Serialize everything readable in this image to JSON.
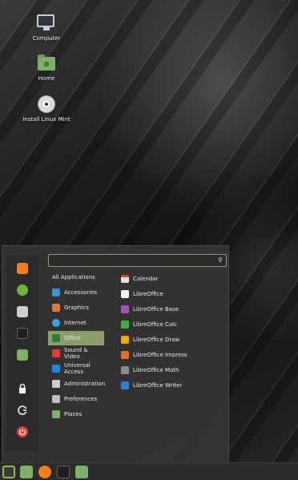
{
  "desktop": {
    "icons": [
      {
        "label": "Computer",
        "icon": "computer-icon"
      },
      {
        "label": "Home",
        "icon": "home-folder-icon"
      },
      {
        "label": "Install Linux Mint",
        "icon": "disc-icon"
      }
    ]
  },
  "menu": {
    "search": {
      "placeholder": "",
      "icon": "search-icon"
    },
    "favorites": [
      {
        "name": "firefox",
        "color": "#f57c1f"
      },
      {
        "name": "software-manager",
        "color": "#6fb23f"
      },
      {
        "name": "settings",
        "color": "#cfcfcf"
      },
      {
        "name": "terminal",
        "color": "#1e1e1e"
      },
      {
        "name": "files",
        "color": "#7fb069"
      },
      {
        "name": "lock-screen",
        "color": "#f2f2f2"
      },
      {
        "name": "logout",
        "color": "#f2f2f2"
      },
      {
        "name": "quit",
        "color": "#e53935"
      }
    ],
    "categories": [
      {
        "label": "All Applications",
        "color": "",
        "selected": false
      },
      {
        "label": "Accessories",
        "color": "#3d8fd6",
        "selected": false
      },
      {
        "label": "Graphics",
        "color": "#e07b39",
        "selected": false
      },
      {
        "label": "Internet",
        "color": "#3aa0e8",
        "selected": false
      },
      {
        "label": "Office",
        "color": "#2e7d32",
        "selected": true
      },
      {
        "label": "Sound & Video",
        "color": "#e53935",
        "selected": false
      },
      {
        "label": "Universal Access",
        "color": "#1e88e5",
        "selected": false
      },
      {
        "label": "Administration",
        "color": "#cccccc",
        "selected": false
      },
      {
        "label": "Preferences",
        "color": "#bdbdbd",
        "selected": false
      },
      {
        "label": "Places",
        "color": "#7fb069",
        "selected": false
      }
    ],
    "apps": [
      {
        "label": "Calendar",
        "color": "#e0e0e0"
      },
      {
        "label": "LibreOffice",
        "color": "#f5f5f5"
      },
      {
        "label": "LibreOffice Base",
        "color": "#a34fc2"
      },
      {
        "label": "LibreOffice Calc",
        "color": "#3cb043"
      },
      {
        "label": "LibreOffice Draw",
        "color": "#f2a900"
      },
      {
        "label": "LibreOffice Impress",
        "color": "#e8692a"
      },
      {
        "label": "LibreOffice Math",
        "color": "#8c8c8c"
      },
      {
        "label": "LibreOffice Writer",
        "color": "#2d7fd3"
      }
    ]
  },
  "panel": {
    "buttons": [
      {
        "name": "menu-button",
        "color": "#8fbf3f"
      },
      {
        "name": "files",
        "color": "#7fb069"
      },
      {
        "name": "firefox",
        "color": "#f57c1f"
      },
      {
        "name": "terminal",
        "color": "#1e1e1e"
      },
      {
        "name": "folder",
        "color": "#7fb069"
      }
    ]
  }
}
